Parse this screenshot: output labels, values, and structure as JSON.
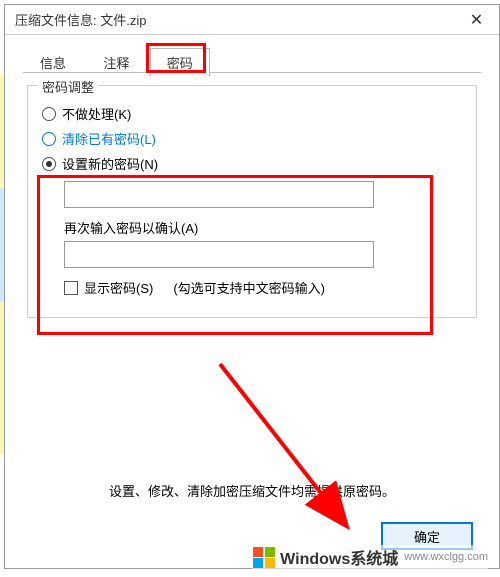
{
  "window": {
    "title": "压缩文件信息: 文件.zip",
    "close_icon": "✕"
  },
  "tabs": {
    "info": "信息",
    "comment": "注释",
    "password": "密码"
  },
  "fieldset": {
    "legend": "密码调整",
    "radio_none": "不做处理(K)",
    "radio_clear": "清除已有密码(L)",
    "radio_set": "设置新的密码(N)",
    "confirm_label": "再次输入密码以确认(A)",
    "show_password": "显示密码(S)",
    "cn_hint": "(勾选可支持中文密码输入)"
  },
  "bottom_hint": "设置、修改、清除加密压缩文件均需提供原密码。",
  "buttons": {
    "ok": "确定"
  },
  "watermark": {
    "text": "Windows系统城",
    "link": "www.wxclgg.com"
  }
}
